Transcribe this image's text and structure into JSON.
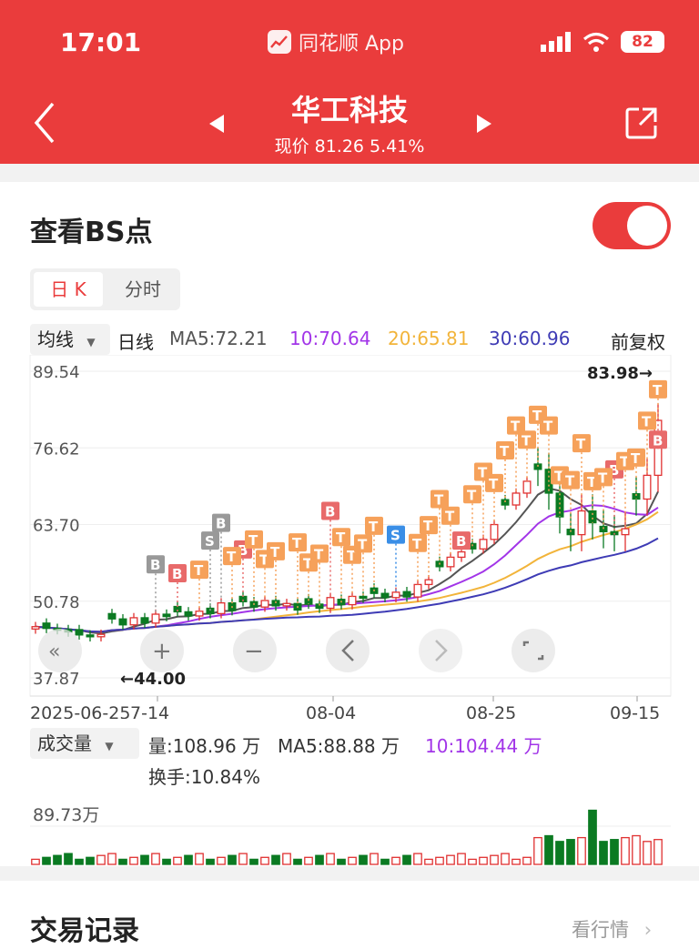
{
  "status_bar": {
    "time": "17:01",
    "app_name": "同花顺 App",
    "battery": "82"
  },
  "header": {
    "stock_name": "华工科技",
    "quote": "现价 81.26 5.41%"
  },
  "bs_panel": {
    "title": "查看BS点",
    "toggle_on": true,
    "tabs": [
      "日 K",
      "分时"
    ],
    "active_tab": "日 K"
  },
  "ma_row": {
    "select_label": "均线",
    "period": "日线",
    "ma5": "MA5:72.21",
    "ma10": "10:70.64",
    "ma20": "20:65.81",
    "ma30": "30:60.96",
    "adjust": "前复权"
  },
  "colors": {
    "brand_red": "#ea3c3c",
    "up": "#e03131",
    "down": "#0b7a22",
    "ma5": "#555555",
    "ma10": "#a235e8",
    "ma20": "#f2b43a",
    "ma30": "#3e3bb5",
    "marker_b": "#e86a6a",
    "marker_s": "#3a8ee6",
    "marker_t": "#f6a15a",
    "marker_gray": "#999999"
  },
  "chart_data": {
    "type": "candlestick",
    "y_ticks": [
      "89.54",
      "76.62",
      "63.70",
      "50.78",
      "37.87"
    ],
    "ylim": [
      37.87,
      89.54
    ],
    "high_label": "83.98→",
    "low_label": "←44.00",
    "x_tick_labels": [
      "2025-06-25",
      "7-14",
      "08-04",
      "08-25",
      "09-15"
    ],
    "close": [
      46.5,
      46.2,
      46.0,
      45.6,
      45.1,
      44.8,
      45.2,
      47.8,
      46.8,
      48.0,
      47.1,
      48.6,
      48.2,
      49.0,
      48.3,
      49.1,
      48.7,
      50.5,
      49.2,
      50.7,
      49.8,
      50.9,
      50.0,
      50.4,
      49.3,
      50.3,
      49.6,
      51.4,
      50.2,
      51.6,
      51.3,
      52.1,
      51.4,
      52.3,
      51.5,
      53.6,
      54.4,
      56.6,
      58.2,
      59.1,
      59.6,
      61.2,
      63.7,
      67.0,
      69.0,
      71.0,
      73.0,
      69.0,
      65.0,
      62.0,
      66.0,
      64.0,
      62.5,
      62.0,
      63.0,
      68.0,
      72.0,
      81.26
    ],
    "ma_labels": {
      "ma5": "MA5:72.21",
      "ma10": "10:70.64",
      "ma20": "20:65.81",
      "ma30": "30:60.96"
    }
  },
  "controls": {
    "zoom_in": "+",
    "zoom_out": "−"
  },
  "volume_panel": {
    "select_label": "成交量",
    "volume": "量:108.96 万",
    "ma5": "MA5:88.88 万",
    "ma10": "10:104.44 万",
    "turnover": "换手:10.84%",
    "y_tick": "89.73万"
  },
  "footer": {
    "title": "交易记录",
    "link": "看行情"
  }
}
